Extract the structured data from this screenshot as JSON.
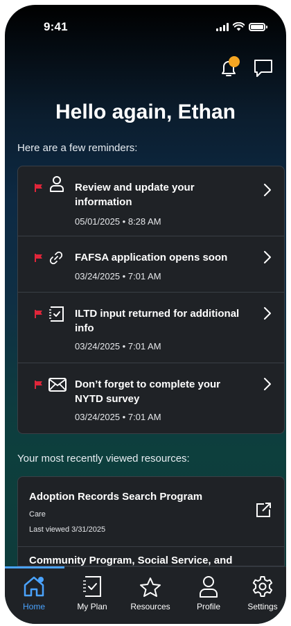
{
  "status_bar": {
    "time": "9:41"
  },
  "greeting": "Hello again, Ethan",
  "reminders_intro": "Here are a few reminders:",
  "reminders": [
    {
      "icon": "person-icon",
      "title": "Review and update your information",
      "date": "05/01/2025 • 8:28 AM"
    },
    {
      "icon": "link-icon",
      "title": "FAFSA application opens soon",
      "date": "03/24/2025 • 7:01 AM"
    },
    {
      "icon": "checklist-icon",
      "title": "ILTD input returned for additional info",
      "date": "03/24/2025 • 7:01 AM"
    },
    {
      "icon": "envelope-icon",
      "title": "Don’t forget to complete your NYTD survey",
      "date": "03/24/2025 • 7:01 AM"
    }
  ],
  "recent_label": "Your most recently viewed resources:",
  "resources": [
    {
      "title": "Adoption Records Search Program",
      "category": "Care",
      "viewed": "Last viewed 3/31/2025"
    },
    {
      "title": "Community Program, Social Service, and"
    }
  ],
  "nav": [
    {
      "label": "Home",
      "icon": "home-icon",
      "active": true
    },
    {
      "label": "My Plan",
      "icon": "checklist-icon",
      "active": false
    },
    {
      "label": "Resources",
      "icon": "star-icon",
      "active": false
    },
    {
      "label": "Profile",
      "icon": "person-icon",
      "active": false
    },
    {
      "label": "Settings",
      "icon": "gear-icon",
      "active": false
    }
  ],
  "colors": {
    "flag": "#e0263a",
    "accent": "#4aa3ff",
    "notification_dot": "#f5a623",
    "card": "#1f2226"
  }
}
